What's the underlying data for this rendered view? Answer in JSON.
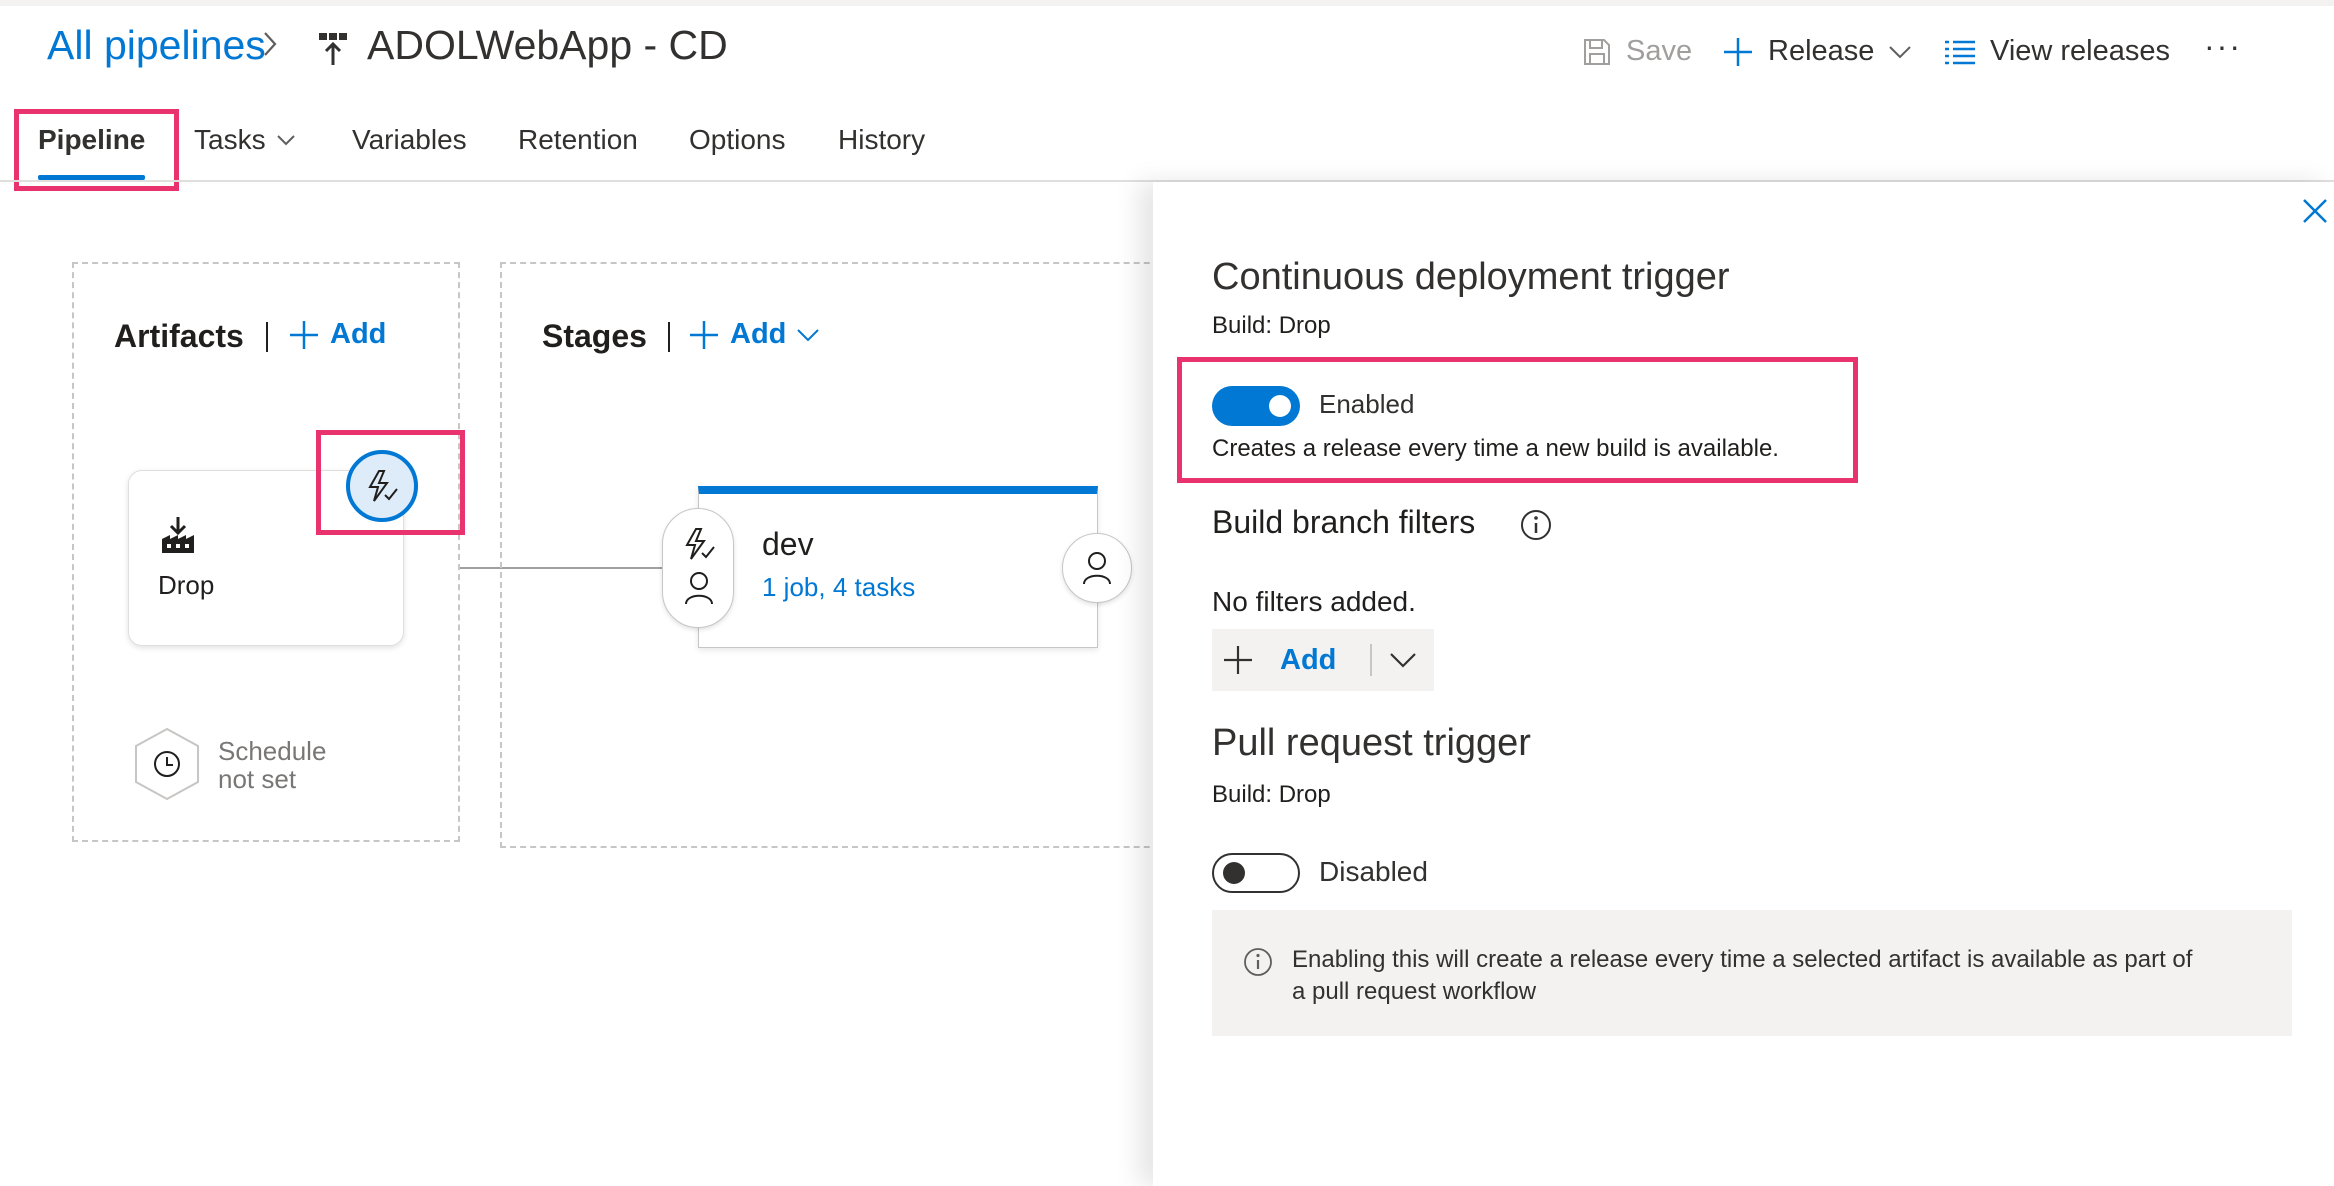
{
  "header": {
    "breadcrumb_root": "All pipelines",
    "pipeline_name": "ADOLWebApp - CD",
    "save_label": "Save",
    "release_label": "Release",
    "view_releases_label": "View releases",
    "more_label": "···"
  },
  "tabs": [
    {
      "label": "Pipeline",
      "active": true
    },
    {
      "label": "Tasks",
      "has_dropdown": true
    },
    {
      "label": "Variables"
    },
    {
      "label": "Retention"
    },
    {
      "label": "Options"
    },
    {
      "label": "History"
    }
  ],
  "artifacts": {
    "title": "Artifacts",
    "add_label": "Add",
    "artifact_name": "Drop",
    "schedule_line1": "Schedule",
    "schedule_line2": "not set"
  },
  "stages": {
    "title": "Stages",
    "add_label": "Add",
    "stage_name": "dev",
    "stage_jobs": "1 job, 4 tasks"
  },
  "panel": {
    "cd_title": "Continuous deployment trigger",
    "cd_build": "Build: Drop",
    "cd_toggle_label": "Enabled",
    "cd_toggle_on": true,
    "cd_desc": "Creates a release every time a new build is available.",
    "branch_filters_title": "Build branch filters",
    "no_filters": "No filters added.",
    "filters_add_label": "Add",
    "pr_title": "Pull request trigger",
    "pr_build": "Build: Drop",
    "pr_toggle_label": "Disabled",
    "pr_toggle_on": false,
    "pr_info_line1": "Enabling this will create a release every time a selected artifact is available as part of",
    "pr_info_line2": "a pull request workflow"
  },
  "colors": {
    "accent": "#0078d4",
    "highlight": "#e8336e",
    "panel_info_bg": "#f3f2f1"
  }
}
